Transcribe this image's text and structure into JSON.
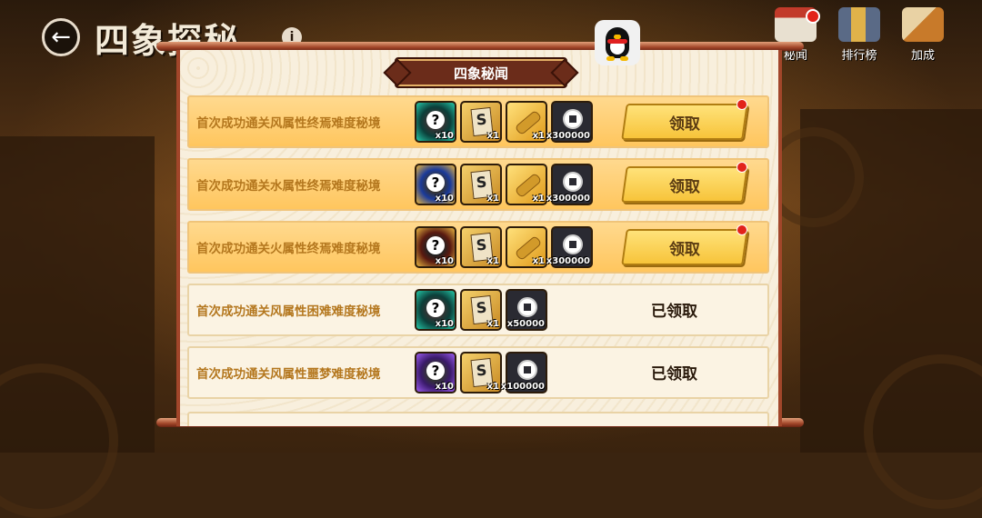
{
  "header": {
    "back_icon": "arrow-left-icon",
    "title": "四象探秘",
    "info_icon": "info-icon"
  },
  "qq_button": {
    "icon": "qq-penguin-icon"
  },
  "top_nav": [
    {
      "label": "秘闻",
      "icon": "secret-news-icon",
      "badge": true
    },
    {
      "label": "排行榜",
      "icon": "leaderboard-icon",
      "badge": false
    },
    {
      "label": "加成",
      "icon": "bonus-icon",
      "badge": false
    }
  ],
  "panel": {
    "title": "四象秘闻",
    "rows": [
      {
        "title": "首次成功通关风属性终焉难度秘境",
        "rewards": [
          {
            "type": "mystery",
            "variant": "cyan",
            "qty": "x10"
          },
          {
            "type": "scroll",
            "qty": "x1"
          },
          {
            "type": "bamboo",
            "qty": "x1"
          },
          {
            "type": "coin",
            "qty": "x300000"
          }
        ],
        "status": "claimable",
        "action_label": "领取"
      },
      {
        "title": "首次成功通关水属性终焉难度秘境",
        "rewards": [
          {
            "type": "mystery",
            "variant": "goldblue",
            "qty": "x10"
          },
          {
            "type": "scroll",
            "qty": "x1"
          },
          {
            "type": "bamboo",
            "qty": "x1"
          },
          {
            "type": "coin",
            "qty": "x300000"
          }
        ],
        "status": "claimable",
        "action_label": "领取"
      },
      {
        "title": "首次成功通关火属性终焉难度秘境",
        "rewards": [
          {
            "type": "mystery",
            "variant": "goldred",
            "qty": "x10"
          },
          {
            "type": "scroll",
            "qty": "x1"
          },
          {
            "type": "bamboo",
            "qty": "x1"
          },
          {
            "type": "coin",
            "qty": "x300000"
          }
        ],
        "status": "claimable",
        "action_label": "领取"
      },
      {
        "title": "首次成功通关风属性困难难度秘境",
        "rewards": [
          {
            "type": "mystery",
            "variant": "cyan",
            "qty": "x10"
          },
          {
            "type": "scroll",
            "qty": "x1"
          },
          {
            "type": "coin",
            "qty": "x50000"
          }
        ],
        "status": "claimed",
        "action_label": "已领取"
      },
      {
        "title": "首次成功通关风属性噩梦难度秘境",
        "rewards": [
          {
            "type": "mystery",
            "variant": "purple",
            "qty": "x10"
          },
          {
            "type": "scroll",
            "qty": "x1"
          },
          {
            "type": "coin",
            "qty": "x100000"
          }
        ],
        "status": "claimed",
        "action_label": "已领取"
      }
    ]
  }
}
